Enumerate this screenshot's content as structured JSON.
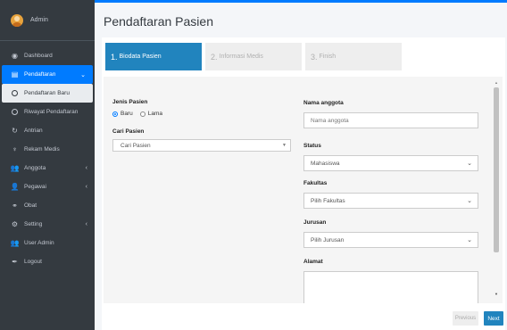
{
  "sidebar": {
    "user": "Admin",
    "items": [
      {
        "label": "Dashboard",
        "icon": "dashboard-icon"
      },
      {
        "label": "Pendaftaran",
        "icon": "form-icon",
        "active": true
      },
      {
        "label": "Pendaftaran Baru",
        "icon": "circle-icon",
        "sub": true
      },
      {
        "label": "Riwayat Pendaftaran",
        "icon": "circle-icon"
      },
      {
        "label": "Antrian",
        "icon": "sync-icon"
      },
      {
        "label": "Rekam Medis",
        "icon": "stethoscope-icon"
      },
      {
        "label": "Anggota",
        "icon": "users-icon"
      },
      {
        "label": "Pegawai",
        "icon": "user-tie-icon"
      },
      {
        "label": "Obat",
        "icon": "pills-icon"
      },
      {
        "label": "Setting",
        "icon": "gear-icon"
      },
      {
        "label": "User Admin",
        "icon": "users-cog-icon"
      },
      {
        "label": "Logout",
        "icon": "feather-icon"
      }
    ]
  },
  "page": {
    "title": "Pendaftaran Pasien"
  },
  "steps": [
    {
      "num": "1.",
      "label": "Biodata Pasien"
    },
    {
      "num": "2.",
      "label": "Informasi Medis"
    },
    {
      "num": "3.",
      "label": "Finish"
    }
  ],
  "form": {
    "jenis_label": "Jenis Pasien",
    "opt_baru": "Baru",
    "opt_lama": "Lama",
    "cari_label": "Cari Pasien",
    "cari_value": "Cari Pasien",
    "nama_label": "Nama anggota",
    "nama_placeholder": "Nama anggota",
    "status_label": "Status",
    "status_value": "Mahasiswa",
    "fakultas_label": "Fakultas",
    "fakultas_value": "Pilih Fakultas",
    "jurusan_label": "Jurusan",
    "jurusan_value": "Pilih Jurusan",
    "alamat_label": "Alamat"
  },
  "buttons": {
    "previous": "Previous",
    "next": "Next"
  },
  "colors": {
    "accent": "#007bff",
    "step_active": "#2184be",
    "sidebar": "#343a40"
  }
}
